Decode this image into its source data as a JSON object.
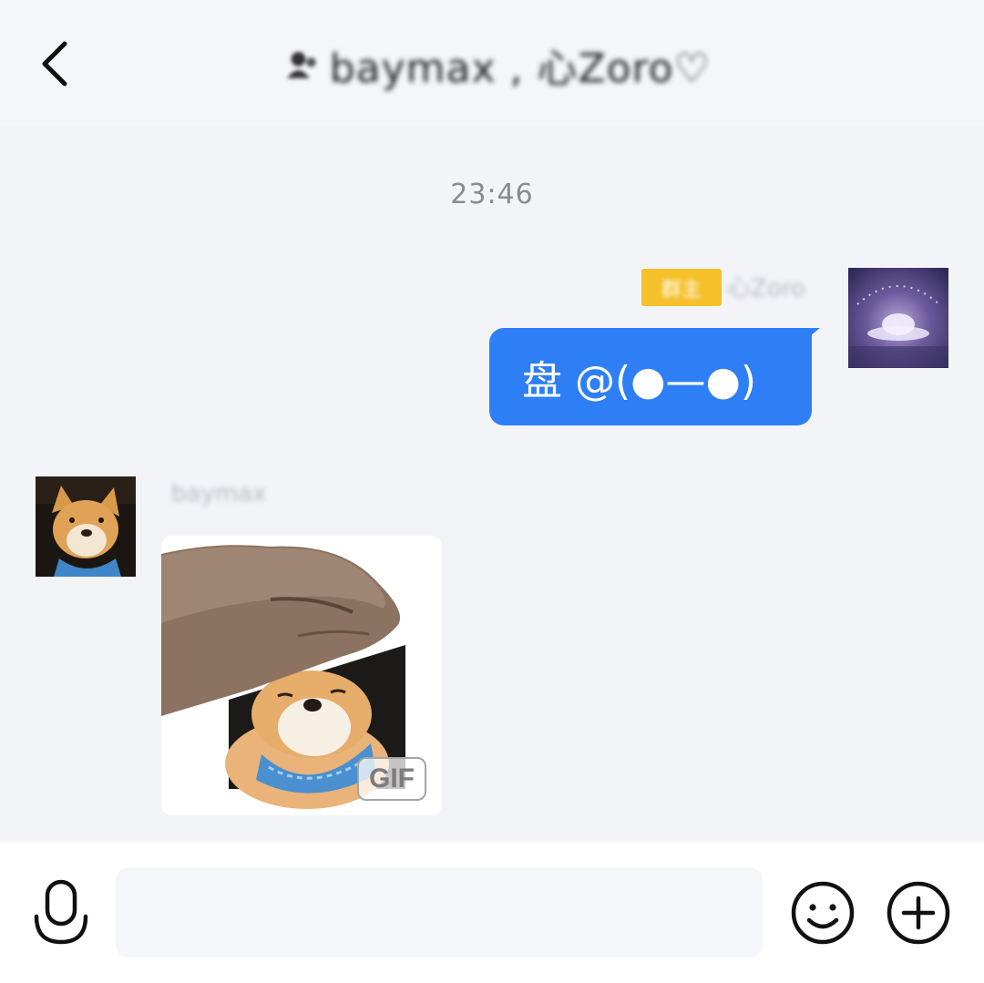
{
  "header": {
    "title": "baymax , 心Zoro♡",
    "back_icon": "chevron-left-icon",
    "title_icon": "group-icon"
  },
  "messages": [
    {
      "type": "timestamp",
      "text": "23:46"
    },
    {
      "direction": "outgoing",
      "badge_text": "群主",
      "sender_name": "心Zoro",
      "text": "盘 @(●—●)",
      "bubble_color": "#2e7ff6",
      "badge_color": "#f5c02a"
    },
    {
      "direction": "incoming",
      "sender_name": "baymax",
      "content_type": "sticker",
      "sticker_tag": "GIF"
    }
  ],
  "input_bar": {
    "mic_icon": "microphone-icon",
    "input_value": "",
    "emoji_icon": "smiley-icon",
    "plus_icon": "plus-circle-icon"
  },
  "colors": {
    "background": "#f3f4f8",
    "header_background": "#f5f6fa",
    "timestamp_color": "#8a8a8f"
  }
}
